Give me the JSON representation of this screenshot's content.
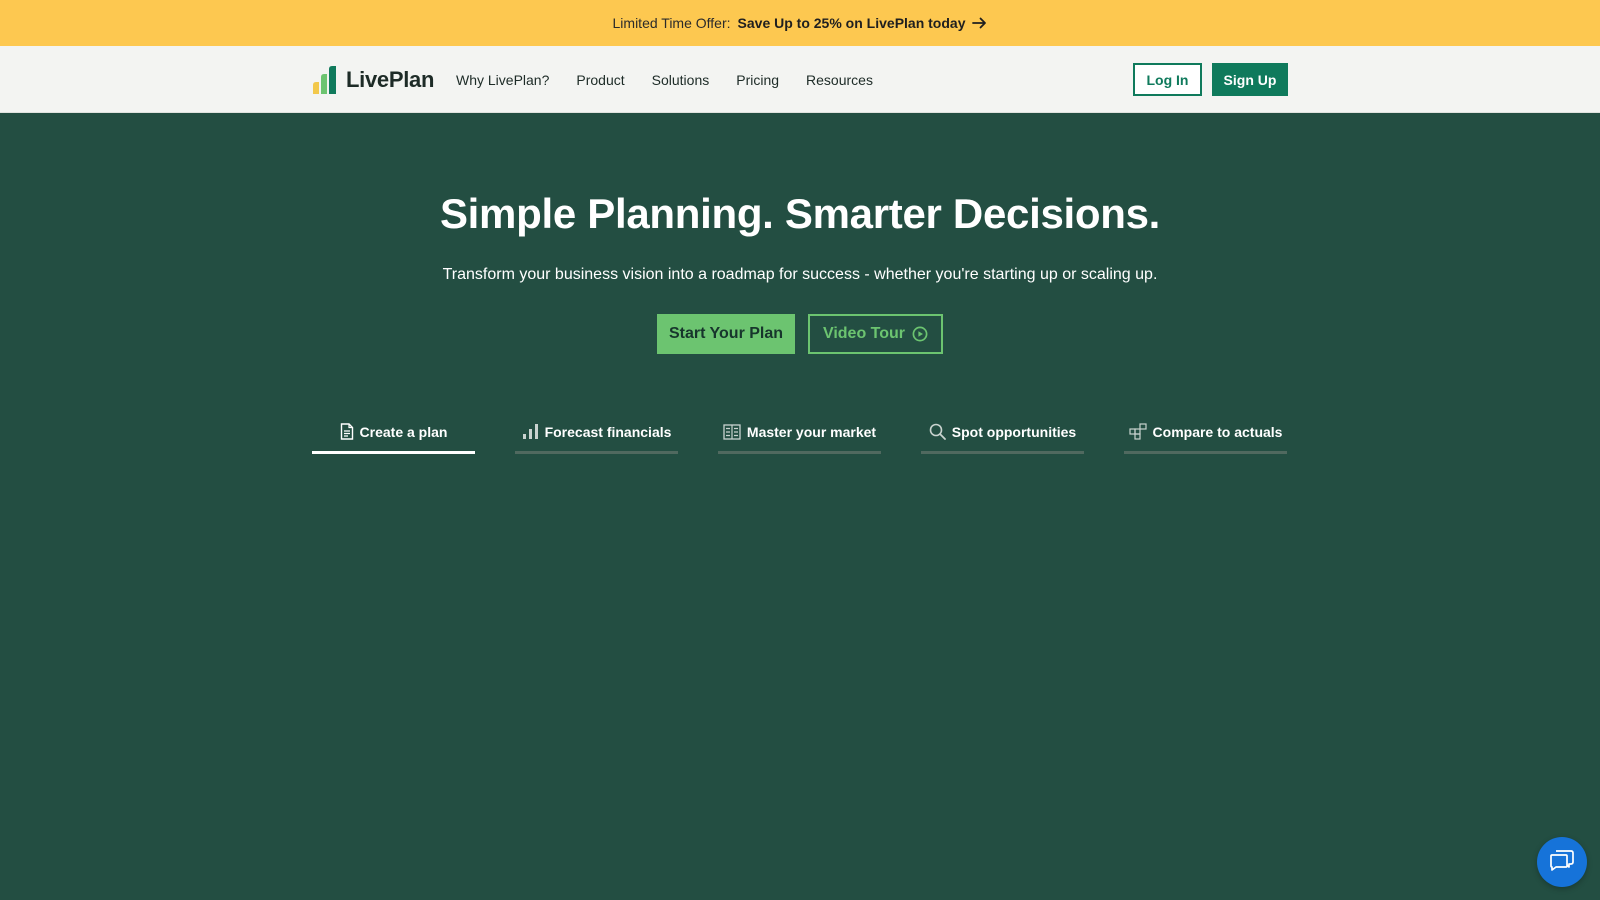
{
  "promo": {
    "lead": "Limited Time Offer:",
    "cta": "Save Up to 25% on LivePlan today",
    "background": "#fdc850"
  },
  "nav": {
    "logo_text": "LivePlan",
    "menu": [
      {
        "label": "Why LivePlan?"
      },
      {
        "label": "Product"
      },
      {
        "label": "Solutions"
      },
      {
        "label": "Pricing"
      },
      {
        "label": "Resources"
      }
    ],
    "login_label": "Log In",
    "signup_label": "Sign Up"
  },
  "hero": {
    "title": "Simple Planning. Smarter Decisions.",
    "subtitle": "Transform your business vision into a roadmap for success - whether you're starting up or scaling up.",
    "primary_cta": "Start Your Plan",
    "secondary_cta": "Video Tour",
    "background": "#234e42"
  },
  "tabs": [
    {
      "label": "Create a plan",
      "icon": "document-icon",
      "active": true
    },
    {
      "label": "Forecast financials",
      "icon": "bar-chart-icon",
      "active": false
    },
    {
      "label": "Master your market",
      "icon": "building-icon",
      "active": false
    },
    {
      "label": "Spot opportunities",
      "icon": "search-icon",
      "active": false
    },
    {
      "label": "Compare to actuals",
      "icon": "compare-grid-icon",
      "active": false
    }
  ],
  "chat": {
    "icon": "chat-icon"
  },
  "colors": {
    "brand_green": "#0f7a5c",
    "accent_green": "#6cc470",
    "chat_blue": "#1673d9"
  }
}
